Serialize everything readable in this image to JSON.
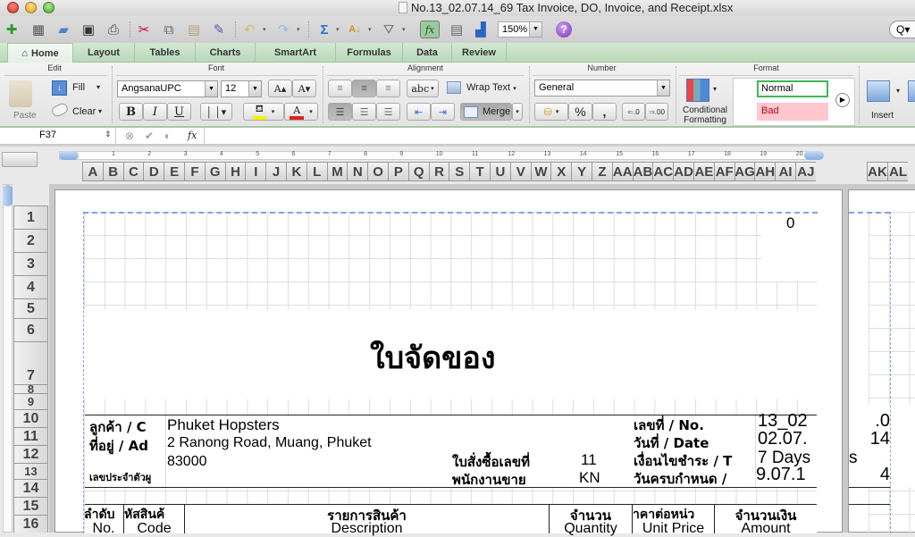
{
  "window": {
    "title": "No.13_02.07.14_69 Tax Invoice, DO, Invoice, and Receipt.xlsx"
  },
  "toolbar": {
    "icons": [
      "new-workbook-icon",
      "templates-icon",
      "open-icon",
      "save-icon",
      "print-icon",
      "cut-icon",
      "copy-icon",
      "paste-icon",
      "format-painter-icon",
      "undo-icon",
      "redo-icon",
      "autosum-icon",
      "sort-icon",
      "filter-icon",
      "formula-builder-icon",
      "gallery-icon",
      "media-browser-icon",
      "help-icon"
    ],
    "zoom": "150%",
    "search_glyph": "Q▾"
  },
  "tabs": [
    {
      "label": "Home",
      "active": true
    },
    {
      "label": "Layout"
    },
    {
      "label": "Tables"
    },
    {
      "label": "Charts"
    },
    {
      "label": "SmartArt"
    },
    {
      "label": "Formulas"
    },
    {
      "label": "Data"
    },
    {
      "label": "Review"
    }
  ],
  "ribbon": {
    "groups": {
      "edit": "Edit",
      "font": "Font",
      "alignment": "Alignment",
      "number": "Number",
      "format": "Format"
    },
    "edit": {
      "paste": "Paste",
      "fill": "Fill",
      "clear": "Clear"
    },
    "font": {
      "name": "AngsanaUPC",
      "size": "12",
      "bold": "B",
      "italic": "I",
      "underline": "U",
      "grow": "A▴",
      "shrink": "A▾",
      "font_color_letter": "A",
      "fill_color": "#f7f000",
      "font_color": "#e02020"
    },
    "alignment": {
      "wrap_text": "Wrap Text",
      "merge": "Merge",
      "orient": "abc"
    },
    "number": {
      "format": "General",
      "percent": "%",
      "comma": ","
    },
    "format": {
      "conditional": "Conditional Formatting",
      "styles": [
        {
          "label": "Normal"
        },
        {
          "label": "Bad"
        }
      ]
    },
    "cells": {
      "insert": "Insert"
    }
  },
  "formula_bar": {
    "name_box": "F37",
    "fx": "fx",
    "value": ""
  },
  "columns": [
    "A",
    "B",
    "C",
    "D",
    "E",
    "F",
    "G",
    "H",
    "I",
    "J",
    "K",
    "L",
    "M",
    "N",
    "O",
    "P",
    "Q",
    "R",
    "S",
    "T",
    "U",
    "V",
    "W",
    "X",
    "Y",
    "Z",
    "AA",
    "AB",
    "AC",
    "AD",
    "AE",
    "AF",
    "AG",
    "AH",
    "AI",
    "AJ"
  ],
  "columns_page2": [
    "AK",
    "AL"
  ],
  "ruler_marks": [
    "1",
    "2",
    "3",
    "4",
    "5",
    "6",
    "7",
    "8",
    "9",
    "10",
    "11",
    "12",
    "13",
    "14",
    "15",
    "16",
    "17",
    "18",
    "19",
    "20"
  ],
  "rows": [
    "1",
    "2",
    "3",
    "4",
    "5",
    "6",
    "7",
    "8",
    "9",
    "10",
    "11",
    "12",
    "13",
    "14",
    "15",
    "16"
  ],
  "sheet": {
    "r1_value": "0",
    "doc_title": "ใบจัดของ",
    "customer_label": "ลูกค้า / C",
    "customer_value": "Phuket Hopsters",
    "address_label": "ที่อยู่ / Ad",
    "address_line1": "2 Ranong Road, Muang, Phuket",
    "address_line2": "83000",
    "taxid_label": "เลขประจำตัวผู",
    "po_label": "ใบสั่งซื้อเลขที่",
    "po_value": "11",
    "sales_label": "พนักงานขาย",
    "sales_value": "KN",
    "no_label": "เลขที่ / No.",
    "no_value": "13_02",
    "no_value_overflow": ".0",
    "date_label": "วันที่ / Date",
    "date_value": "02.07.",
    "date_value_overflow": "14",
    "terms_label": "เงื่อนไขชำระ / T",
    "terms_value": "7  Days",
    "terms_value_overflow": "s",
    "due_label": "วันครบกำหนด /",
    "due_value": "9.07.1",
    "due_value_overflow": "4",
    "table_headers": [
      {
        "th": "ลำดับ",
        "en": "No."
      },
      {
        "th": "หัสสินค้",
        "en": "Code"
      },
      {
        "th": "รายการสินค้า",
        "en": "Description"
      },
      {
        "th": "จำนวน",
        "en": "Quantity"
      },
      {
        "th": "าคาต่อหน่ว",
        "en": "Unit Price"
      },
      {
        "th": "จำนวนเงิน",
        "en": "Amount"
      }
    ]
  }
}
